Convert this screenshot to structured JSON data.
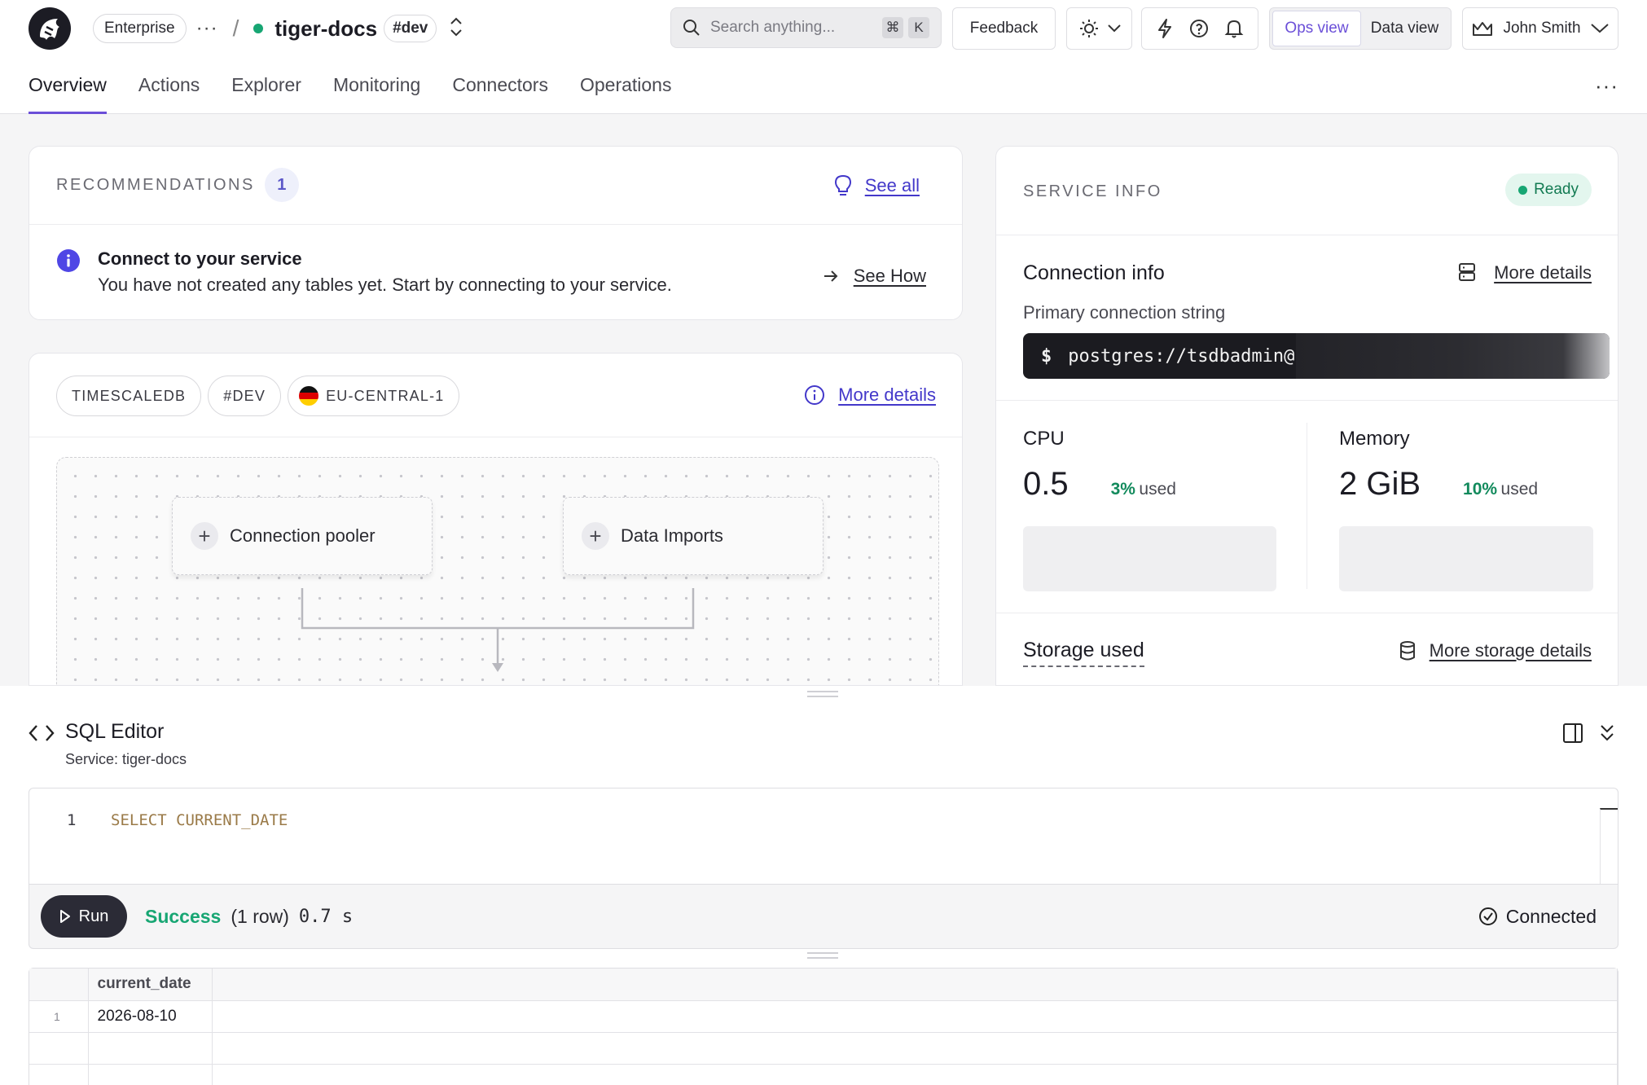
{
  "header": {
    "org": "Enterprise",
    "breadcrumb_sep": "/",
    "service_name": "tiger-docs",
    "service_tag": "#dev",
    "search_placeholder": "Search anything...",
    "search_key_1": "⌘",
    "search_key_2": "K",
    "feedback_label": "Feedback",
    "ops_view_label": "Ops view",
    "data_view_label": "Data view",
    "user_name": "John Smith"
  },
  "tabs": [
    {
      "label": "Overview",
      "active": true
    },
    {
      "label": "Actions"
    },
    {
      "label": "Explorer"
    },
    {
      "label": "Monitoring"
    },
    {
      "label": "Connectors"
    },
    {
      "label": "Operations"
    }
  ],
  "recommendations": {
    "title": "RECOMMENDATIONS",
    "count": "1",
    "see_all_label": "See all",
    "item_title": "Connect to your service",
    "item_body": "You have not created any tables yet. Start by connecting to your service.",
    "item_action": "See How"
  },
  "service_card": {
    "chips": [
      "TIMESCALEDB",
      "#DEV",
      "EU-CENTRAL-1"
    ],
    "more_details_label": "More details",
    "nodes": [
      "Connection pooler",
      "Data Imports"
    ]
  },
  "service_info": {
    "title": "SERVICE INFO",
    "status": "Ready",
    "connection_title": "Connection info",
    "more_details_label": "More details",
    "primary_label": "Primary connection string",
    "prompt": "$",
    "connection_string": "postgres://tsdbadmin@",
    "cpu_label": "CPU",
    "cpu_value": "0.5",
    "cpu_used_pct": "3%",
    "used_word": "used",
    "memory_label": "Memory",
    "memory_value": "2 GiB",
    "memory_used_pct": "10%",
    "storage_label": "Storage used",
    "storage_link": "More storage details"
  },
  "sql_editor": {
    "title": "SQL Editor",
    "service_line": "Service: tiger-docs",
    "line_number": "1",
    "query": "SELECT CURRENT_DATE",
    "run_label": "Run",
    "result_status": "Success",
    "result_rows": "(1 row)",
    "result_time": "0.7 s",
    "connection_status": "Connected",
    "results": {
      "columns": [
        "current_date"
      ],
      "rows": [
        [
          "1",
          "2026-08-10"
        ]
      ]
    }
  },
  "colors": {
    "accent": "#6b4fd8",
    "link": "#4338ca",
    "success": "#17a673",
    "dark": "#1b1b20"
  }
}
